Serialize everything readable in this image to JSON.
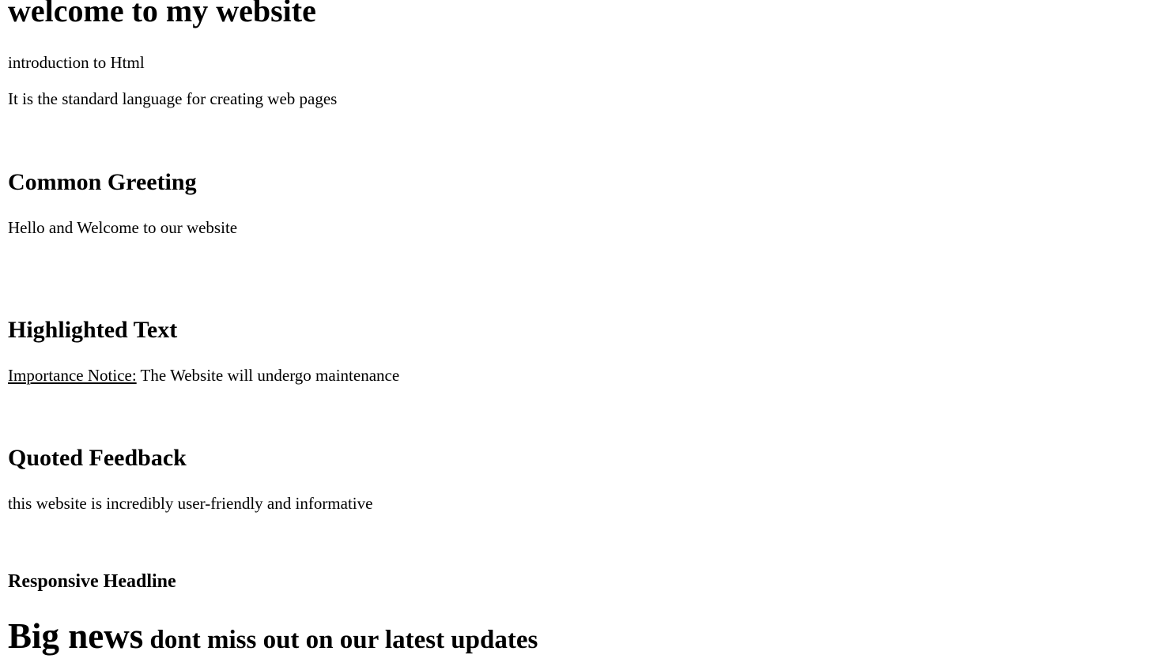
{
  "header": {
    "title": "welcome to my website"
  },
  "intro": {
    "line1": "introduction to Html",
    "line2": "It is the standard language for creating web pages"
  },
  "greeting": {
    "heading": "Common Greeting",
    "text": "Hello and Welcome to our website"
  },
  "highlight": {
    "heading": "Highlighted Text",
    "label": "Importance Notice:",
    "text": " The Website will undergo maintenance"
  },
  "feedback": {
    "heading": "Quoted Feedback",
    "text": "this website is incredibly user-friendly and informative"
  },
  "responsive": {
    "heading": "Responsive Headline",
    "big": "Big news",
    "rest": " dont miss out on our latest updates"
  }
}
